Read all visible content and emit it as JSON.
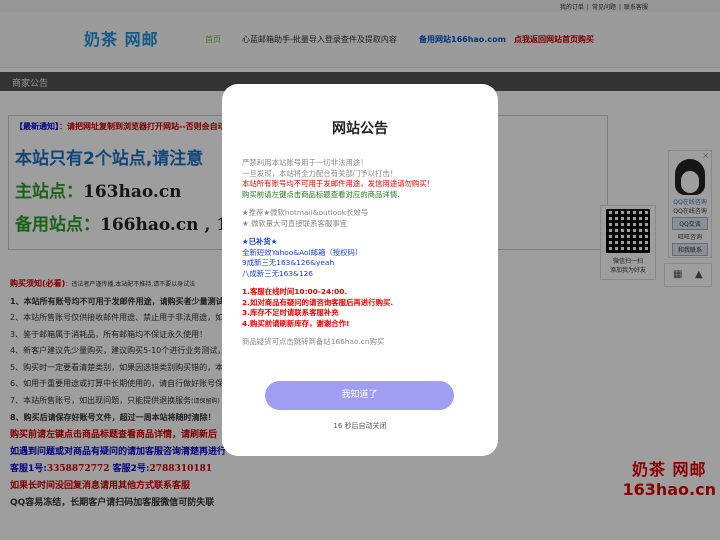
{
  "topbar": {
    "links": [
      "我的订单",
      "常见问题",
      "联系客服"
    ]
  },
  "header": {
    "logo": "奶茶 网邮",
    "nav": {
      "home": "首页",
      "helper": "心蓝邮箱助手-批量导入登录查件及提取内容",
      "backup": "备用网站166hao.com",
      "return": "点我返回网站首页购买"
    }
  },
  "section": {
    "title": "商家公告"
  },
  "notice": {
    "tag": "【最新通知】",
    "text": "：请把网址复制到浏览器打开网站--否则会自动",
    "big1": "本站只有2个站点,请注意",
    "main_label": "主站点：",
    "main_value": "163hao.cn",
    "backup_label": "备用站点：",
    "backup_value": "166hao.cn , 16"
  },
  "rules": {
    "title": "购买须知(必看)",
    "title_note": "：违法者严谨传播,本站配不推持,请不要以身试法",
    "items": [
      "1、本站所有账号均不可用于发邮件用途，请购买者少量测试",
      "2、本站所售账号仅供接收邮件用途、禁止用于非法用途，如",
      "3、鉴于邮箱属于消耗品，所有邮箱均不保证永久使用！",
      "4、新客户建议先少量购买，建议购买5-10个进行业务测试，",
      "5、购买时一定要看清楚类别，如果因选错类别购买错的，本",
      "6、如用于重要用途或打算中长期使用的，请自行做好账号保",
      "7、本站所售账号，如出现问题，只能提供退换服务",
      "8、购买后请保存好账号文件，超过一周本站将随时清除！"
    ],
    "item7_note": "(请保留购)",
    "red1": "购买前请左键点击商品标题查看商品详情，请刷新后",
    "blue1": "如遇到问题或对商品有疑问的请加客服咨询清楚再进行",
    "qq_label1": "客服1号:",
    "qq_value1": "3358872772",
    "qq_label2": "客服2号:",
    "qq_value2": "2788310181",
    "red2": "如果长时间没回复消息请用其他方式联系客服",
    "dark1": "QQ容易冻结，长期客户请扫码加客服微信可防失联"
  },
  "side": {
    "wechat_line1": "微信扫一扫",
    "wechat_line2": "添加我为好友",
    "qq_online": "QQ在线咨询",
    "qq_consult": "QQ在线咨询",
    "qq_btn": "QQ交谈",
    "wangwang": "旺旺咨询",
    "wangwang_btn": "和我联系"
  },
  "brand": {
    "line1": "奶茶 网邮",
    "line2": "163hao.cn"
  },
  "modal": {
    "title": "网站公告",
    "lines": {
      "l1": "严禁利用本站账号用于一切非法用途！",
      "l2": "一旦发现，本站将全力配合有关部门予以打击！",
      "l3": "本站所有账号均不可用于发邮件用途，发信用途请勿购买！",
      "l4": "购买前请左键点击商品标题查看对应的商品详情.",
      "l5": "★推荐★微软hotmail&outlook长效号",
      "l6": "★.微软量大可直接联系客服事宜",
      "l7": "★已补货★",
      "l8": "全新短效Yahoo&Aol邮箱（授权码）",
      "l9": "9成新三无163&126&yeah",
      "l10": "八成新三无163&126",
      "l11": "1.客服在线时间10:00-24:00.",
      "l12": "2.如对商品有疑问的请咨询客服后再进行购买.",
      "l13": "3.库存不足时请联系客服补充",
      "l14": "4.购买前请刷新库存，谢谢合作!",
      "l15": "商品疑货可点击跳转到备站166hao.cn购买"
    },
    "ok": "我知道了",
    "countdown": "16 秒后自动关闭"
  }
}
